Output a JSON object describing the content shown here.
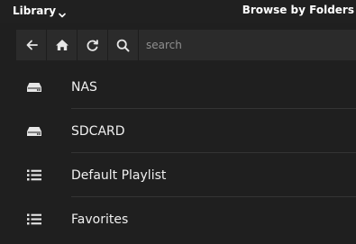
{
  "header": {
    "library_label": "Library",
    "title": "Browse by Folders"
  },
  "toolbar": {
    "buttons": [
      "back-arrow-icon",
      "home-icon",
      "refresh-icon",
      "search-icon"
    ],
    "search_placeholder": "search",
    "search_value": ""
  },
  "list": {
    "items": [
      {
        "label": "NAS",
        "icon": "drive-icon"
      },
      {
        "label": "SDCARD",
        "icon": "drive-icon"
      },
      {
        "label": "Default Playlist",
        "icon": "list-icon"
      },
      {
        "label": "Favorites",
        "icon": "list-icon"
      }
    ]
  }
}
